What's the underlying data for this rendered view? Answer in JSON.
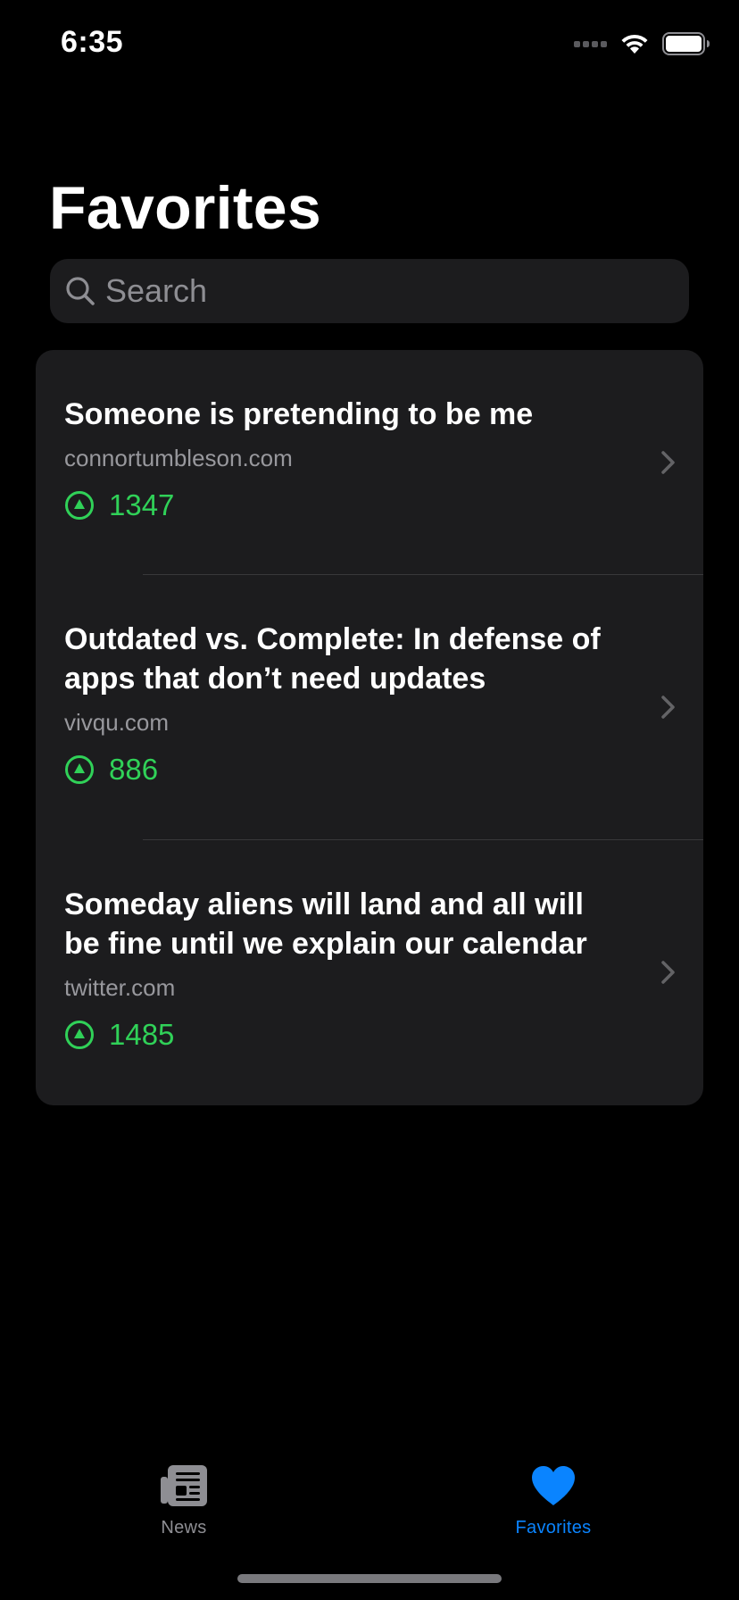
{
  "status_bar": {
    "time": "6:35"
  },
  "header": {
    "title": "Favorites"
  },
  "search": {
    "placeholder": "Search",
    "value": ""
  },
  "items": [
    {
      "title": "Someone is pretending to be me",
      "domain": "connortumbleson.com",
      "score": "1347"
    },
    {
      "title": "Outdated vs. Complete: In defense of apps that don’t need updates",
      "domain": "vivqu.com",
      "score": "886"
    },
    {
      "title": "Someday aliens will land and all will be fine until we explain our calendar",
      "domain": "twitter.com",
      "score": "1485"
    }
  ],
  "tab_bar": {
    "tabs": [
      {
        "label": "News",
        "icon": "newspaper-icon",
        "selected": false
      },
      {
        "label": "Favorites",
        "icon": "heart-icon",
        "selected": true
      }
    ]
  },
  "colors": {
    "background": "#000000",
    "card": "#1c1c1e",
    "accent": "#0a84ff",
    "score_green": "#30d158",
    "secondary_text": "#98989d"
  }
}
